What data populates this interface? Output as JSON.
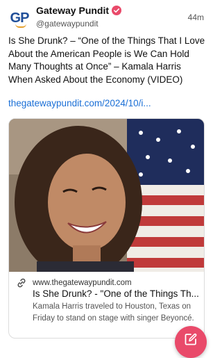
{
  "post": {
    "author": {
      "avatar_text": "GP",
      "display_name": "Gateway Pundit",
      "handle": "@gatewaypundit",
      "verified": true
    },
    "timestamp": "44m",
    "text": "Is She Drunk? – “One of the Things That I Love About the American People is We Can Hold Many Thoughts at Once” – Kamala Harris When Asked About the Economy (VIDEO)",
    "link": "thegatewaypundit.com/2024/10/i..."
  },
  "card": {
    "image_icon": "portrait-photo",
    "link_icon": "link-icon",
    "domain": "www.thegatewaypundit.com",
    "title": "Is She Drunk? - \"One of the Things Th...",
    "description": "Kamala Harris traveled to Houston, Texas on Friday to stand on stage with singer Beyoncé."
  },
  "fab": {
    "icon": "compose-icon"
  },
  "colors": {
    "link": "#1a6fd6",
    "avatar_blue": "#1f4e99",
    "verified_badge": "#e94a6a",
    "fab": "#e94a6a"
  }
}
